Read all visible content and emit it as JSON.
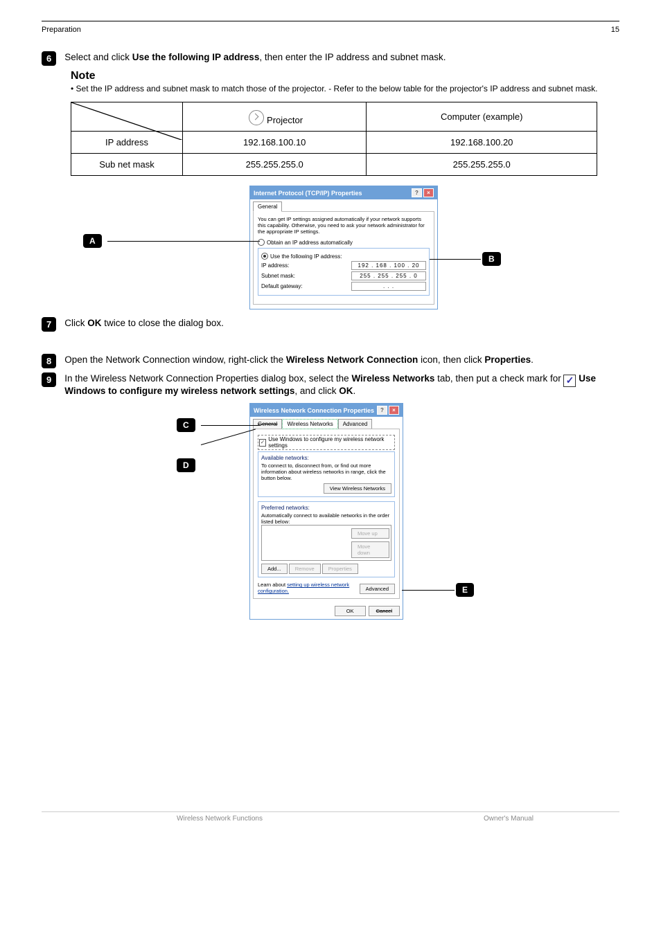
{
  "header": {
    "left": "Preparation",
    "right": "15"
  },
  "steps": {
    "s6": {
      "num": "6",
      "textA": "Select and click ",
      "textB": "Use the following IP address",
      "textC": ", then enter the IP address and subnet mask."
    },
    "sA": {
      "num": "A"
    },
    "sB": {
      "num": "B"
    },
    "s7": {
      "num": "7",
      "textA": "Click ",
      "textB": "OK",
      "textC": " twice to close the dialog box."
    },
    "s8": {
      "num": "8",
      "textA": "Open the Network Connection window, right-click the ",
      "textB": "Wireless Network Connection",
      "textC": " icon, then click ",
      "textD": "Properties",
      "textE": "."
    },
    "s9": {
      "num": "9",
      "textA": "In the Wireless Network Connection Properties dialog box, select the ",
      "textB": "Wireless Networks",
      "textC": " tab, then put a check mark for ",
      "textD": "Use Windows to configure my wireless network settings",
      "textE": ", and click ",
      "textF": "OK",
      "textG": "."
    },
    "c1": {
      "num": "C"
    },
    "c2": {
      "num": "D"
    },
    "c3": {
      "num": "E"
    }
  },
  "note": {
    "title": "Note",
    "body": "• Set the IP address and subnet mask to match those of the projector. - Refer to the below table for the projector's IP address and subnet mask."
  },
  "table": {
    "colProjector": "Projector",
    "colComputer": "Computer",
    "colExample": "(example)",
    "rowIp": "IP address",
    "rowMask": "Sub net mask",
    "ipProjector": "192.168.100.10",
    "ipComputer": "192.168.100.20",
    "maskProjector": "255.255.255.0",
    "maskComputer": "255.255.255.0"
  },
  "tcpip": {
    "title": "Internet Protocol (TCP/IP) Properties",
    "tab": "General",
    "desc": "You can get IP settings assigned automatically if your network supports this capability. Otherwise, you need to ask your network administrator for the appropriate IP settings.",
    "optAuto": "Obtain an IP address automatically",
    "optManual": "Use the following IP address:",
    "labIp": "IP address:",
    "labMask": "Subnet mask:",
    "labGw": "Default gateway:",
    "valIp": "192 . 168 . 100 . 20",
    "valMask": "255 . 255 . 255 .  0",
    "valGw": ".     .     ."
  },
  "wlan": {
    "title": "Wireless Network Connection Properties",
    "tabGeneral": "General",
    "tabWireless": "Wireless Networks",
    "tabAdvanced": "Advanced",
    "chk": "Use Windows to configure my wireless network settings",
    "grpAvail": "Available networks:",
    "availDesc": "To connect to, disconnect from, or find out more information about wireless networks in range, click the button below.",
    "btnView": "View Wireless Networks",
    "grpPref": "Preferred networks:",
    "prefDesc": "Automatically connect to available networks in the order listed below:",
    "btnUp": "Move up",
    "btnDown": "Move down",
    "btnAdd": "Add...",
    "btnRemove": "Remove",
    "btnProps": "Properties",
    "learn": "Learn about ",
    "learnLink": "setting up wireless network configuration.",
    "btnAdvanced": "Advanced",
    "btnOk": "OK",
    "btnCancel": "Cancel"
  },
  "footer": {
    "left": "Wireless Network Functions",
    "right": "Owner's Manual"
  }
}
